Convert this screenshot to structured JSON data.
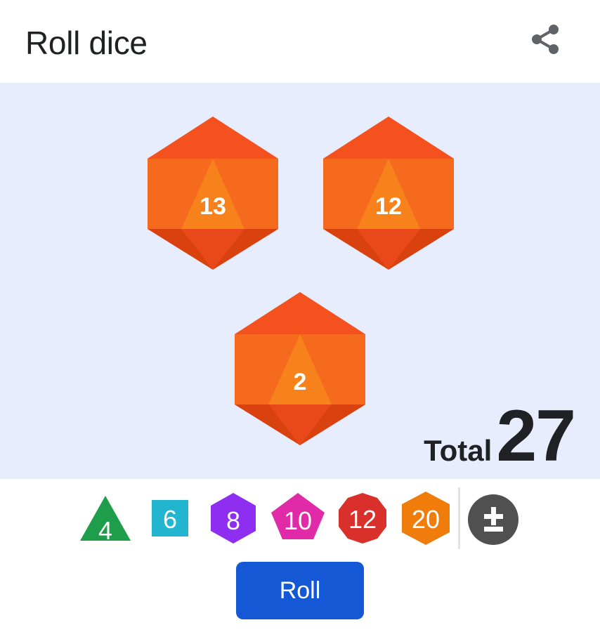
{
  "header": {
    "title": "Roll dice",
    "share_icon": "share-icon"
  },
  "dice_color": "#f4601e",
  "rolled_dice": [
    {
      "type": "d20",
      "value": "13"
    },
    {
      "type": "d20",
      "value": "12"
    },
    {
      "type": "d20",
      "value": "2"
    }
  ],
  "total": {
    "label": "Total",
    "value": "27"
  },
  "dice_picker": [
    {
      "label": "4",
      "shape": "triangle",
      "color": "#1e9e4a"
    },
    {
      "label": "6",
      "shape": "square",
      "color": "#22b5cf"
    },
    {
      "label": "8",
      "shape": "hexagon",
      "color": "#8e2ef0"
    },
    {
      "label": "10",
      "shape": "diamond",
      "color": "#e02aa8"
    },
    {
      "label": "12",
      "shape": "decagon",
      "color": "#d9302b"
    },
    {
      "label": "20",
      "shape": "hexagon",
      "color": "#f07c0c"
    }
  ],
  "modifier_icon": "plus-minus-icon",
  "roll_button": {
    "label": "Roll",
    "color": "#1558d6"
  }
}
